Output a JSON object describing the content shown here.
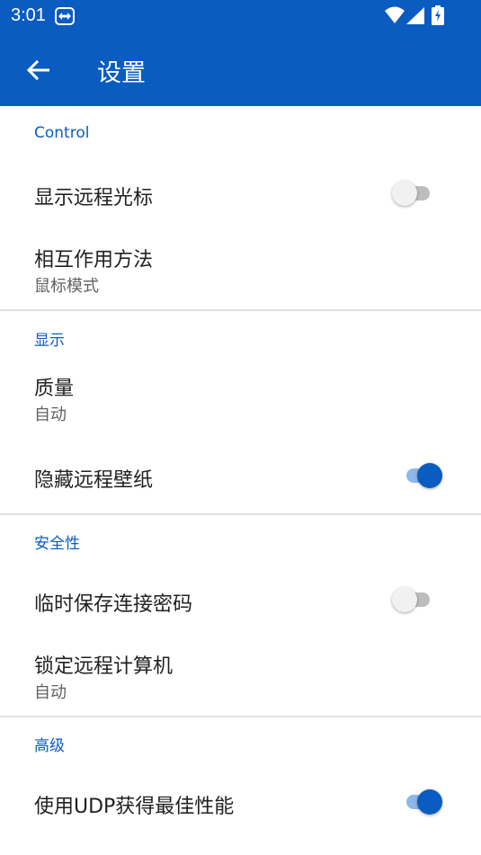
{
  "status_bar": {
    "time": "3:01"
  },
  "app_bar": {
    "title": "设置"
  },
  "sections": [
    {
      "header": "Control",
      "rows": [
        {
          "label": "显示远程光标",
          "toggle": false
        },
        {
          "label": "相互作用方法",
          "value": "鼠标模式"
        }
      ]
    },
    {
      "header": "显示",
      "rows": [
        {
          "label": "质量",
          "value": "自动"
        },
        {
          "label": "隐藏远程壁纸",
          "toggle": true
        }
      ]
    },
    {
      "header": "安全性",
      "rows": [
        {
          "label": "临时保存连接密码",
          "toggle": false
        },
        {
          "label": "锁定远程计算机",
          "value": "自动"
        }
      ]
    },
    {
      "header": "高级",
      "rows": [
        {
          "label": "使用UDP获得最佳性能",
          "toggle": true
        }
      ]
    }
  ],
  "colors": {
    "primary": "#0a5cc1",
    "switch_track_on": "#8fb8ea",
    "switch_off": "#f1f1f1"
  }
}
